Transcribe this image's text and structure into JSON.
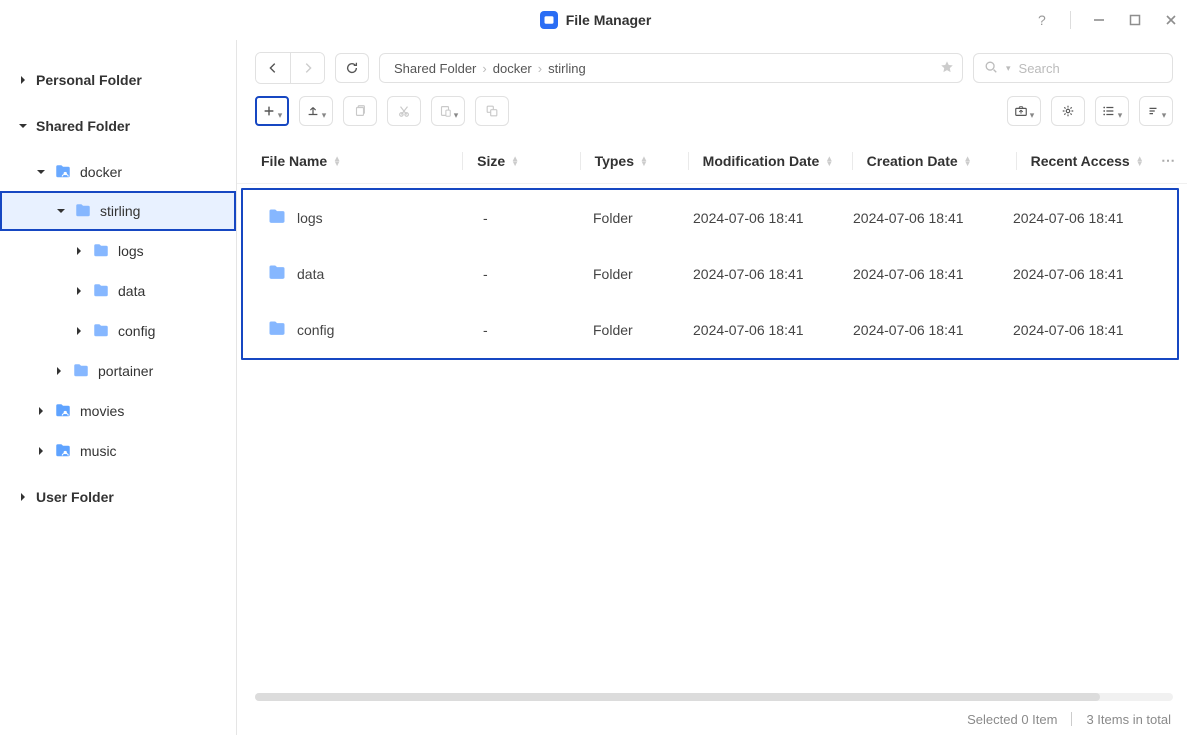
{
  "app": {
    "title": "File Manager"
  },
  "window_controls": {},
  "sidebar": {
    "roots": [
      {
        "label": "Personal Folder",
        "expanded": false
      },
      {
        "label": "Shared Folder",
        "expanded": true
      },
      {
        "label": "User Folder",
        "expanded": false
      }
    ],
    "shared_children": {
      "docker": {
        "label": "docker",
        "expanded": true
      },
      "stirling": {
        "label": "stirling",
        "expanded": true,
        "selected": true
      },
      "stirling_children": [
        {
          "label": "logs"
        },
        {
          "label": "data"
        },
        {
          "label": "config"
        }
      ],
      "portainer": {
        "label": "portainer",
        "expanded": false
      },
      "movies": {
        "label": "movies",
        "expanded": false
      },
      "music": {
        "label": "music",
        "expanded": false
      }
    }
  },
  "breadcrumb": [
    "Shared Folder",
    "docker",
    "stirling"
  ],
  "search": {
    "placeholder": "Search"
  },
  "columns": {
    "name": "File Name",
    "size": "Size",
    "type": "Types",
    "mod": "Modification Date",
    "crt": "Creation Date",
    "acc": "Recent Access"
  },
  "rows": [
    {
      "name": "logs",
      "size": "-",
      "type": "Folder",
      "mod": "2024-07-06 18:41",
      "crt": "2024-07-06 18:41",
      "acc": "2024-07-06 18:41"
    },
    {
      "name": "data",
      "size": "-",
      "type": "Folder",
      "mod": "2024-07-06 18:41",
      "crt": "2024-07-06 18:41",
      "acc": "2024-07-06 18:41"
    },
    {
      "name": "config",
      "size": "-",
      "type": "Folder",
      "mod": "2024-07-06 18:41",
      "crt": "2024-07-06 18:41",
      "acc": "2024-07-06 18:41"
    }
  ],
  "status": {
    "selected": "Selected 0 Item",
    "total": "3 Items in total"
  }
}
